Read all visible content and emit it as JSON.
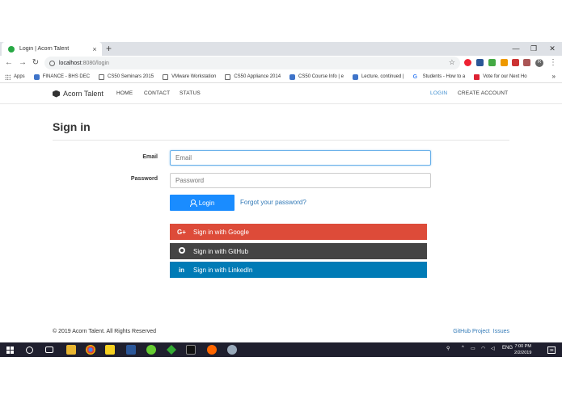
{
  "browser": {
    "tab_title": "Login | Acorn Talent",
    "tab_close": "×",
    "new_tab": "+",
    "url_host": "localhost",
    "url_rest": ":8080/login",
    "window_controls": [
      "—",
      "❐",
      "✕"
    ],
    "profile_letter": "R"
  },
  "bookmarks": {
    "items": [
      {
        "label": "Apps",
        "icon": "apps-grid-icon"
      },
      {
        "label": "FINANCE - BHS DEC",
        "icon": "wave-icon"
      },
      {
        "label": "CS50 Seminars 2015",
        "icon": "page-icon"
      },
      {
        "label": "VMware Workstation",
        "icon": "page-icon"
      },
      {
        "label": "CS50 Appliance 2014",
        "icon": "page-icon"
      },
      {
        "label": "CS50 Course Info | e",
        "icon": "edx-icon"
      },
      {
        "label": "Lecture, continued |",
        "icon": "edx-icon"
      },
      {
        "label": "Students - How to a",
        "icon": "google-icon"
      },
      {
        "label": "Vote for our Next Ho",
        "icon": "vote-icon"
      }
    ],
    "more": "»"
  },
  "app": {
    "brand": "Acorn Talent",
    "nav": {
      "home": "HOME",
      "contact": "CONTACT",
      "status": "STATUS",
      "login": "LOGIN",
      "create_account": "CREATE ACCOUNT"
    },
    "accent_color": "#3a8ccf",
    "heading": "Sign in",
    "form": {
      "email_label": "Email",
      "email_placeholder": "Email",
      "password_label": "Password",
      "password_placeholder": "Password",
      "login_button": "Login",
      "forgot_link": "Forgot your password?"
    },
    "social": {
      "google_icon": "G+",
      "google": "Sign in with Google",
      "google_color": "#dd4b39",
      "github": "Sign in with GitHub",
      "github_color": "#444444",
      "linkedin_icon": "in",
      "linkedin": "Sign in with LinkedIn",
      "linkedin_color": "#007bb6"
    },
    "footer": {
      "copyright": "© 2019 Acorn Talent. All Rights Reserved",
      "github_project": "GitHub Project",
      "issues": "Issues"
    }
  },
  "taskbar": {
    "language": "ENG",
    "time": "7:00 PM",
    "date": "2/2/2019",
    "notification_count": "38"
  }
}
